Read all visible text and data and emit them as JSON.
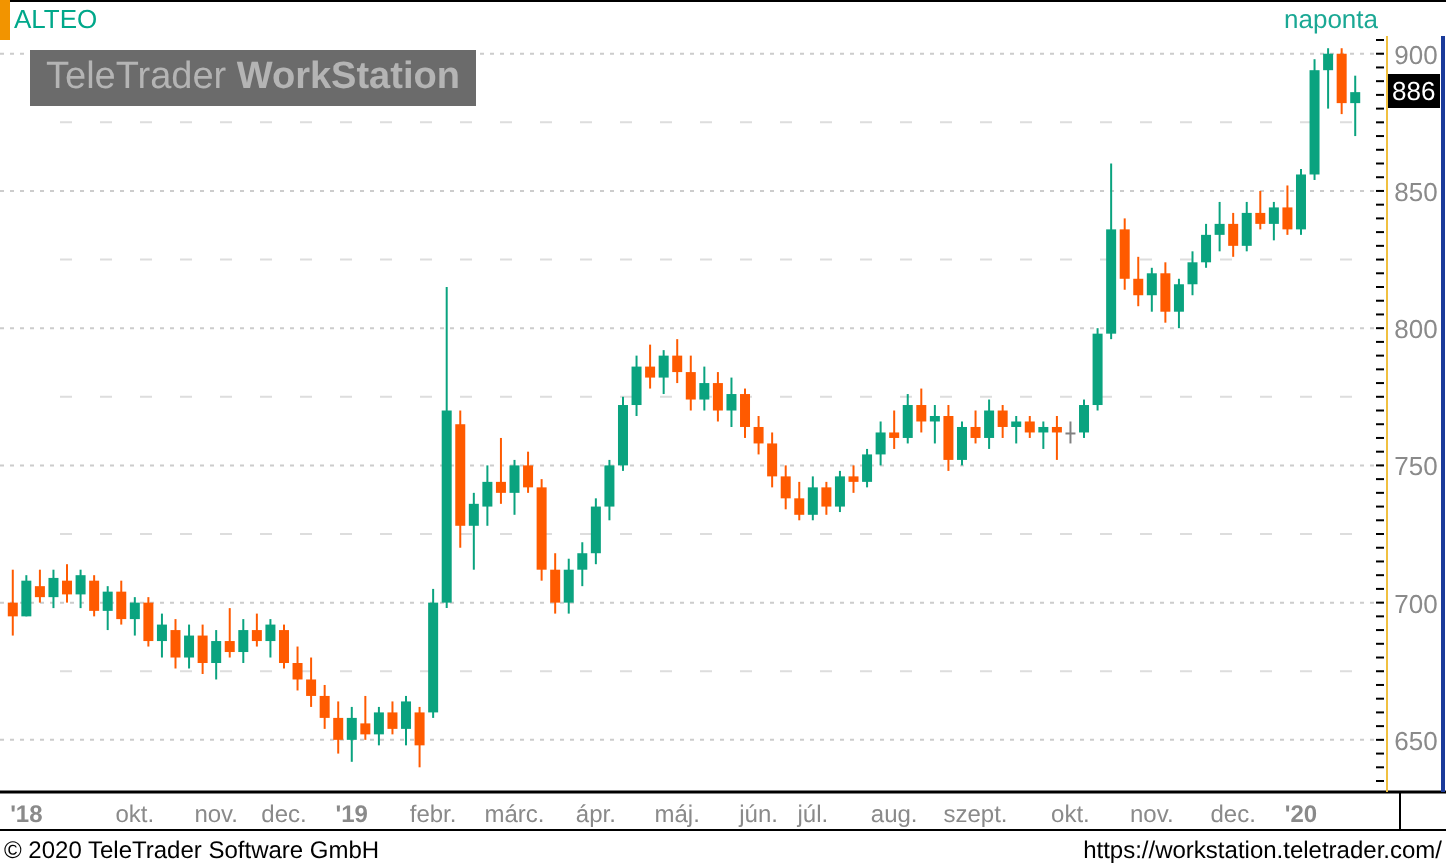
{
  "chart": {
    "symbol": "ALTEO",
    "interval": "naponta",
    "logo": "TeleTrader **WorkStation**",
    "last_price": "886",
    "chart_data": {
      "type": "candlestick",
      "grid": true,
      "ylim": [
        631,
        905
      ],
      "yticks": [
        650,
        700,
        750,
        800,
        850,
        900
      ],
      "categories": [
        null,
        "'18",
        null,
        null,
        null,
        null,
        null,
        null,
        null,
        "okt.",
        null,
        null,
        null,
        null,
        null,
        "nov.",
        null,
        null,
        null,
        null,
        "dec.",
        null,
        null,
        null,
        null,
        "'19",
        null,
        null,
        null,
        null,
        null,
        "febr.",
        null,
        null,
        null,
        null,
        null,
        "márc.",
        null,
        null,
        null,
        null,
        null,
        "ápr.",
        null,
        null,
        null,
        null,
        null,
        "máj.",
        null,
        null,
        null,
        null,
        null,
        "jún.",
        null,
        null,
        null,
        "júl.",
        null,
        null,
        null,
        null,
        null,
        "aug.",
        null,
        null,
        null,
        null,
        null,
        "szept.",
        null,
        null,
        null,
        null,
        null,
        null,
        "okt.",
        null,
        null,
        null,
        null,
        null,
        "nov.",
        null,
        null,
        null,
        null,
        null,
        "dec.",
        null,
        null,
        null,
        null,
        "'20",
        null,
        null,
        null,
        null
      ],
      "ohlc": [
        [
          700,
          712,
          688,
          695
        ],
        [
          695,
          710,
          695,
          708
        ],
        [
          706,
          712,
          700,
          702
        ],
        [
          702,
          712,
          698,
          709
        ],
        [
          708,
          714,
          700,
          703
        ],
        [
          703,
          712,
          698,
          710
        ],
        [
          708,
          710,
          695,
          697
        ],
        [
          697,
          706,
          690,
          704
        ],
        [
          704,
          708,
          692,
          694
        ],
        [
          694,
          702,
          688,
          700
        ],
        [
          700,
          702,
          684,
          686
        ],
        [
          686,
          696,
          680,
          692
        ],
        [
          690,
          694,
          676,
          680
        ],
        [
          680,
          692,
          676,
          688
        ],
        [
          688,
          692,
          674,
          678
        ],
        [
          678,
          690,
          672,
          686
        ],
        [
          686,
          698,
          680,
          682
        ],
        [
          682,
          694,
          678,
          690
        ],
        [
          690,
          696,
          684,
          686
        ],
        [
          686,
          694,
          680,
          692
        ],
        [
          690,
          692,
          676,
          678
        ],
        [
          678,
          684,
          668,
          672
        ],
        [
          672,
          680,
          662,
          666
        ],
        [
          666,
          670,
          654,
          658
        ],
        [
          658,
          664,
          645,
          650
        ],
        [
          650,
          662,
          642,
          658
        ],
        [
          656,
          666,
          650,
          652
        ],
        [
          652,
          662,
          648,
          660
        ],
        [
          660,
          664,
          652,
          654
        ],
        [
          654,
          666,
          648,
          664
        ],
        [
          660,
          662,
          640,
          648
        ],
        [
          660,
          705,
          658,
          700
        ],
        [
          700,
          815,
          698,
          770
        ],
        [
          765,
          770,
          720,
          728
        ],
        [
          728,
          740,
          712,
          736
        ],
        [
          735,
          750,
          728,
          744
        ],
        [
          744,
          760,
          736,
          740
        ],
        [
          740,
          752,
          732,
          750
        ],
        [
          750,
          755,
          740,
          742
        ],
        [
          742,
          745,
          708,
          712
        ],
        [
          712,
          718,
          696,
          700
        ],
        [
          700,
          716,
          696,
          712
        ],
        [
          712,
          722,
          706,
          718
        ],
        [
          718,
          738,
          714,
          735
        ],
        [
          735,
          752,
          730,
          750
        ],
        [
          750,
          775,
          748,
          772
        ],
        [
          772,
          790,
          768,
          786
        ],
        [
          786,
          794,
          778,
          782
        ],
        [
          782,
          792,
          776,
          790
        ],
        [
          790,
          796,
          780,
          784
        ],
        [
          784,
          790,
          770,
          774
        ],
        [
          774,
          786,
          770,
          780
        ],
        [
          780,
          784,
          766,
          770
        ],
        [
          770,
          782,
          764,
          776
        ],
        [
          776,
          778,
          760,
          764
        ],
        [
          764,
          768,
          754,
          758
        ],
        [
          758,
          762,
          742,
          746
        ],
        [
          746,
          750,
          734,
          738
        ],
        [
          738,
          744,
          730,
          732
        ],
        [
          732,
          746,
          730,
          742
        ],
        [
          742,
          744,
          732,
          735
        ],
        [
          735,
          748,
          733,
          746
        ],
        [
          746,
          750,
          740,
          744
        ],
        [
          744,
          756,
          742,
          754
        ],
        [
          754,
          766,
          750,
          762
        ],
        [
          762,
          770,
          756,
          760
        ],
        [
          760,
          776,
          758,
          772
        ],
        [
          772,
          778,
          762,
          766
        ],
        [
          766,
          772,
          758,
          768
        ],
        [
          768,
          772,
          748,
          752
        ],
        [
          752,
          766,
          750,
          764
        ],
        [
          764,
          770,
          758,
          760
        ],
        [
          760,
          774,
          756,
          770
        ],
        [
          770,
          772,
          760,
          764
        ],
        [
          764,
          768,
          758,
          766
        ],
        [
          766,
          768,
          760,
          762
        ],
        [
          762,
          766,
          756,
          764
        ],
        [
          764,
          768,
          752,
          762
        ],
        [
          762,
          766,
          758,
          762
        ],
        [
          762,
          774,
          760,
          772
        ],
        [
          772,
          800,
          770,
          798
        ],
        [
          798,
          860,
          796,
          836
        ],
        [
          836,
          840,
          814,
          818
        ],
        [
          818,
          826,
          808,
          812
        ],
        [
          812,
          822,
          806,
          820
        ],
        [
          820,
          824,
          802,
          806
        ],
        [
          806,
          818,
          800,
          816
        ],
        [
          816,
          828,
          812,
          824
        ],
        [
          824,
          838,
          822,
          834
        ],
        [
          834,
          846,
          828,
          838
        ],
        [
          838,
          842,
          826,
          830
        ],
        [
          830,
          846,
          828,
          842
        ],
        [
          842,
          850,
          836,
          838
        ],
        [
          838,
          846,
          832,
          844
        ],
        [
          844,
          852,
          834,
          836
        ],
        [
          836,
          858,
          834,
          856
        ],
        [
          856,
          898,
          854,
          894
        ],
        [
          894,
          902,
          880,
          900
        ],
        [
          900,
          902,
          878,
          882
        ],
        [
          882,
          892,
          870,
          886
        ]
      ]
    }
  },
  "footer": {
    "copyright": "© 2020 TeleTrader Software GmbH",
    "url": "https://workstation.teletrader.com/"
  }
}
